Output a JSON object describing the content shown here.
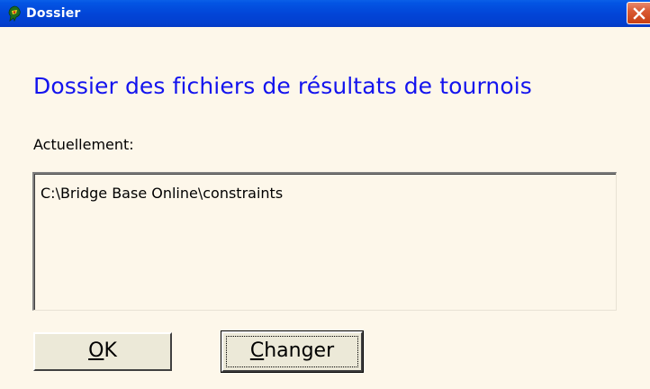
{
  "window": {
    "title": "Dossier",
    "app_icon": "bbo-app-icon",
    "close_icon": "close-icon"
  },
  "dialog": {
    "heading": "Dossier des fichiers de résultats de tournois",
    "current_label": "Actuellement:",
    "current_path": "C:\\Bridge Base Online\\constraints"
  },
  "buttons": {
    "ok": {
      "mnemonic": "O",
      "rest": "K"
    },
    "change": {
      "mnemonic": "C",
      "rest": "hanger"
    }
  },
  "colors": {
    "titlebar": "#0244d6",
    "heading": "#1313ee",
    "background": "#fdf7ea",
    "button_face": "#ece9d8",
    "close_button": "#da5a34"
  }
}
